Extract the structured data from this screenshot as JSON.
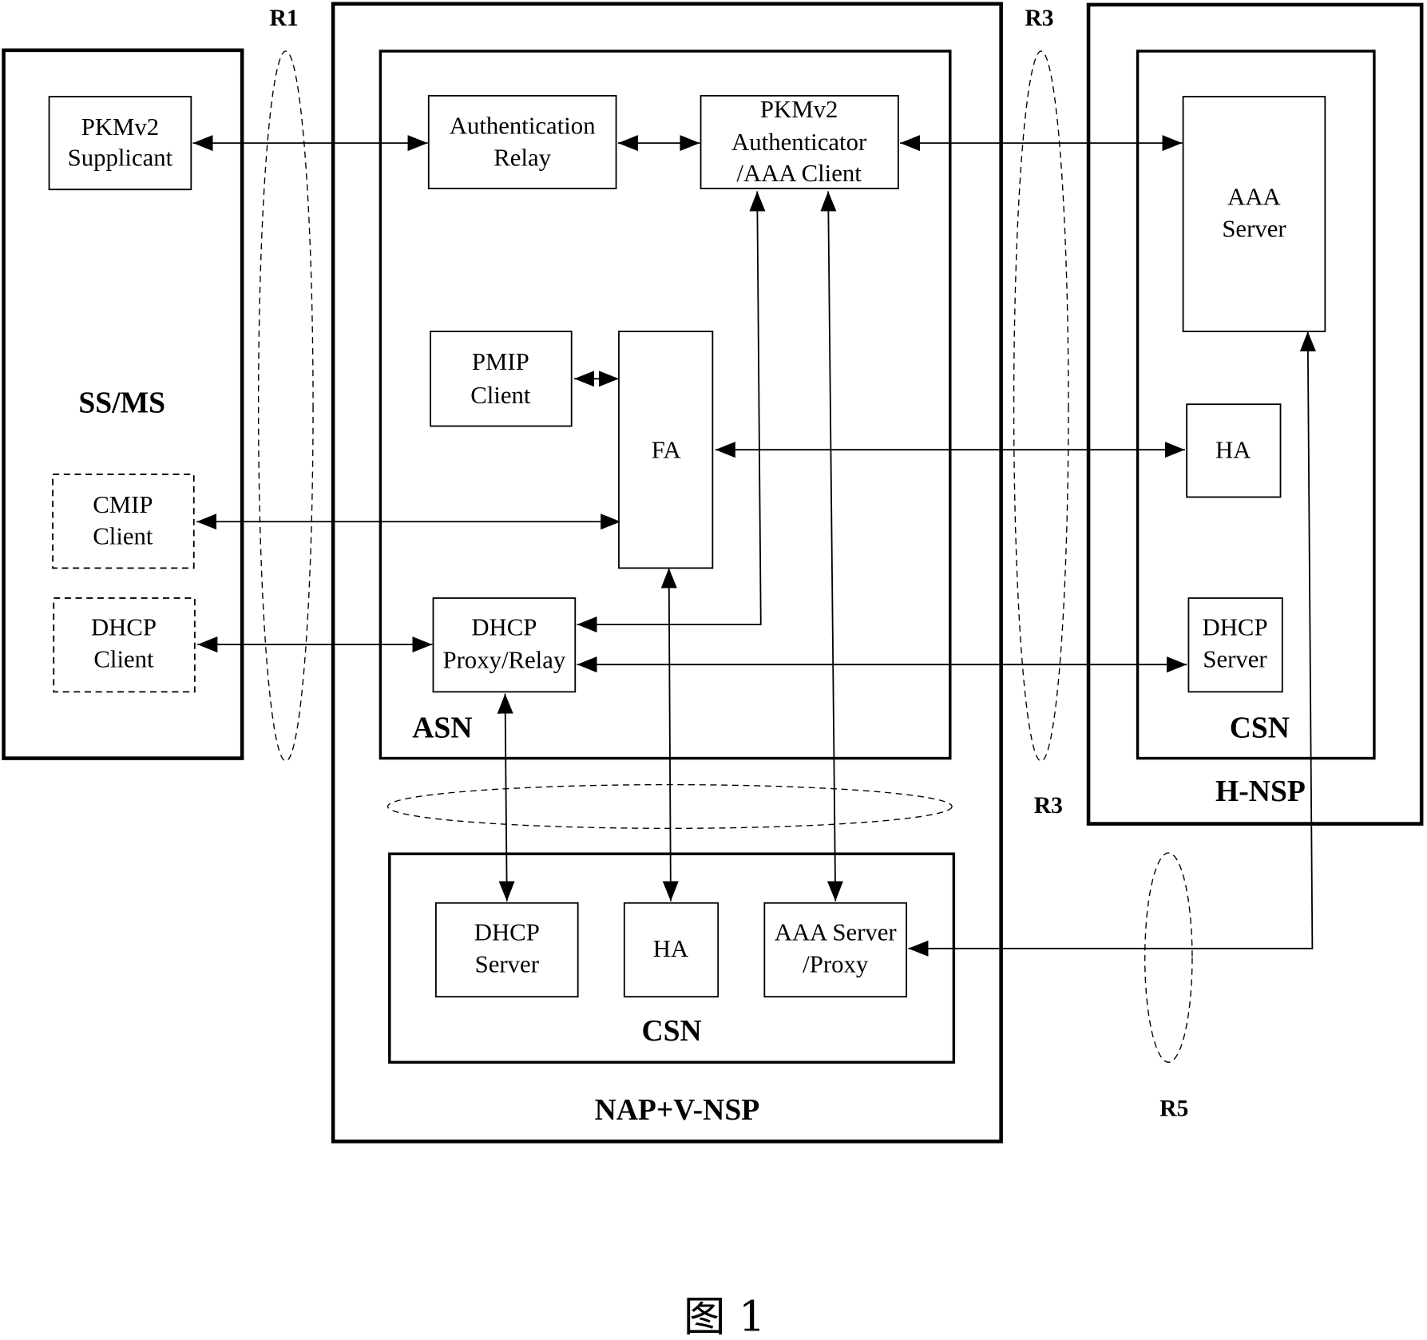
{
  "diagram": {
    "caption": "图 1",
    "reference_points": {
      "r1": "R1",
      "r3_top": "R3",
      "r3_mid": "R3",
      "r5": "R5"
    },
    "domains": {
      "ss_ms": {
        "label": "SS/MS",
        "components": {
          "pkmv2_supplicant": [
            "PKMv2",
            "Supplicant"
          ],
          "cmip_client": [
            "CMIP",
            "Client"
          ],
          "dhcp_client": [
            "DHCP",
            "Client"
          ]
        }
      },
      "nap_vnsp": {
        "label": "NAP+V-NSP",
        "asn": {
          "label": "ASN",
          "components": {
            "authentication_relay": [
              "Authentication",
              "Relay"
            ],
            "pkmv2_authenticator": [
              "PKMv2",
              "Authenticator",
              "/AAA Client"
            ],
            "pmip_client": [
              "PMIP",
              "Client"
            ],
            "fa": [
              "FA"
            ],
            "dhcp_proxy_relay": [
              "DHCP",
              "Proxy/Relay"
            ]
          }
        },
        "csn": {
          "label": "CSN",
          "components": {
            "dhcp_server": [
              "DHCP",
              "Server"
            ],
            "ha": [
              "HA"
            ],
            "aaa_server_proxy": [
              "AAA Server",
              "/Proxy"
            ]
          }
        }
      },
      "h_nsp": {
        "label": "H-NSP",
        "csn": {
          "label": "CSN",
          "components": {
            "aaa_server": [
              "AAA",
              "Server"
            ],
            "ha": [
              "HA"
            ],
            "dhcp_server": [
              "DHCP",
              "Server"
            ]
          }
        }
      }
    },
    "connections": [
      {
        "from": "PKMv2 Supplicant",
        "to": "Authentication Relay",
        "direction": "both"
      },
      {
        "from": "Authentication Relay",
        "to": "PKMv2 Authenticator /AAA Client",
        "direction": "both"
      },
      {
        "from": "PKMv2 Authenticator /AAA Client",
        "to": "H-NSP AAA Server",
        "direction": "both"
      },
      {
        "from": "PMIP Client",
        "to": "FA",
        "direction": "both"
      },
      {
        "from": "FA",
        "to": "H-NSP HA",
        "direction": "both"
      },
      {
        "from": "CMIP Client",
        "to": "FA",
        "direction": "both"
      },
      {
        "from": "DHCP Client",
        "to": "DHCP Proxy/Relay",
        "direction": "both"
      },
      {
        "from": "DHCP Proxy/Relay",
        "to": "H-NSP DHCP Server",
        "direction": "both"
      },
      {
        "from": "PKMv2 Authenticator /AAA Client",
        "to": "DHCP Proxy/Relay",
        "direction": "both"
      },
      {
        "from": "DHCP Proxy/Relay",
        "to": "V-NSP DHCP Server",
        "direction": "both"
      },
      {
        "from": "FA",
        "to": "V-NSP HA",
        "direction": "both"
      },
      {
        "from": "PKMv2 Authenticator /AAA Client",
        "to": "V-NSP AAA Server /Proxy",
        "direction": "both"
      },
      {
        "from": "V-NSP AAA Server /Proxy",
        "to": "H-NSP AAA Server",
        "direction": "both"
      }
    ]
  }
}
